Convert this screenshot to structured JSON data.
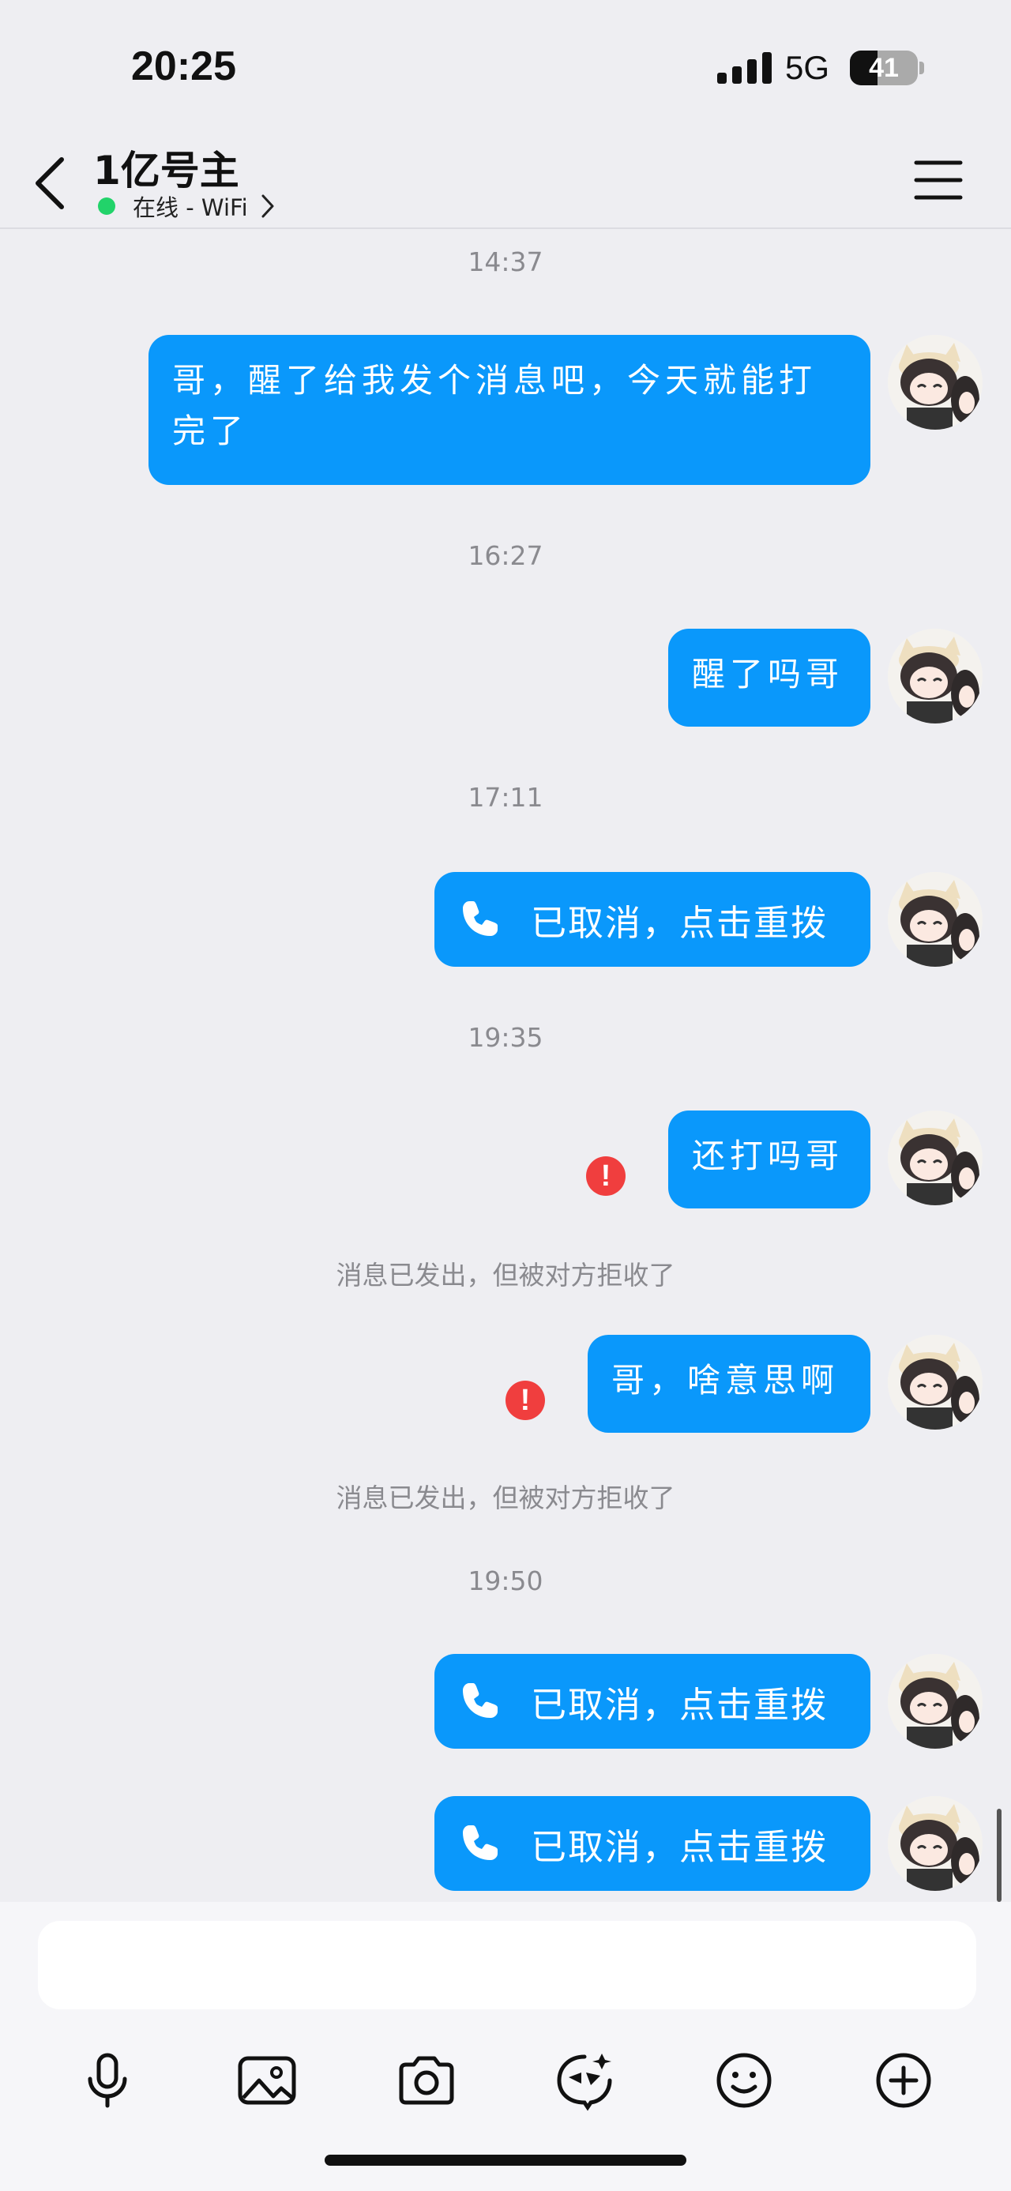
{
  "status": {
    "time": "20:25",
    "network": "5G",
    "battery": "41",
    "battery_level": 0.41
  },
  "header": {
    "title": "1亿号主",
    "presence": "在线 - WiFi"
  },
  "messages": {
    "t1": "14:37",
    "m1": "哥，醒了给我发个消息吧，今天就能打完了",
    "t2": "16:27",
    "m2": "醒了吗哥",
    "t3": "17:11",
    "m3": "已取消，点击重拨",
    "t4": "19:35",
    "m4": "还打吗哥",
    "n1": "消息已发出，但被对方拒收了",
    "m5": "哥，啥意思啊",
    "n2": "消息已发出，但被对方拒收了",
    "t5": "19:50",
    "m6": "已取消，点击重拨",
    "m7": "已取消，点击重拨"
  },
  "error_mark": "!",
  "icons": {
    "toolbar": [
      "microphone-icon",
      "image-icon",
      "camera-icon",
      "sticker-icon",
      "emoji-icon",
      "plus-circle-icon"
    ]
  },
  "colors": {
    "bubble": "#0a98fb",
    "online": "#22d36a",
    "error": "#f03e3e"
  }
}
